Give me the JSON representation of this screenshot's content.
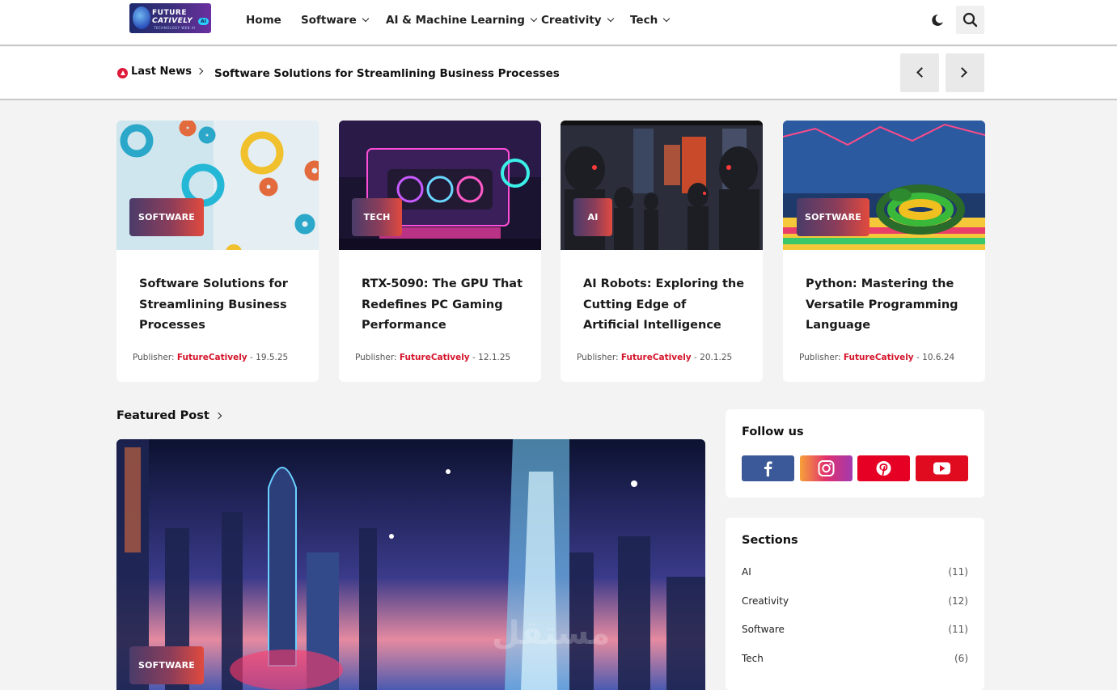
{
  "header": {
    "logo": {
      "line1": "FUTURE",
      "line2": "CATIVELY",
      "line3": "TECHNOLOGY WEB AI",
      "badge": "AI"
    },
    "nav": [
      {
        "label": "Home",
        "dropdown": false
      },
      {
        "label": "Software",
        "dropdown": true
      },
      {
        "label": "AI & Machine Learning",
        "dropdown": true
      },
      {
        "label": "Creativity",
        "dropdown": true
      },
      {
        "label": "Tech",
        "dropdown": true
      }
    ],
    "icons": {
      "theme": "moon-icon",
      "search": "search-icon"
    }
  },
  "newsbar": {
    "label": "Last News",
    "headline": "Software Solutions for Streamlining Business Processes"
  },
  "cards": [
    {
      "badge": "SOFTWARE",
      "title": "Software Solutions for Streamlining Business Processes",
      "publisher_label": "Publisher:",
      "publisher": "FutureCatively",
      "date": "19.5.25"
    },
    {
      "badge": "TECH",
      "title": "RTX-5090: The GPU That Redefines PC Gaming Performance",
      "publisher_label": "Publisher:",
      "publisher": "FutureCatively",
      "date": "12.1.25"
    },
    {
      "badge": "AI",
      "title": "AI Robots: Exploring the Cutting Edge of Artificial Intelligence",
      "publisher_label": "Publisher:",
      "publisher": "FutureCatively",
      "date": "20.1.25"
    },
    {
      "badge": "SOFTWARE",
      "title": "Python: Mastering the Versatile Programming Language",
      "publisher_label": "Publisher:",
      "publisher": "FutureCatively",
      "date": "10.6.24"
    }
  ],
  "featured": {
    "heading": "Featured Post",
    "badge": "SOFTWARE"
  },
  "follow": {
    "title": "Follow us",
    "networks": [
      {
        "name": "facebook-icon",
        "color": "#3b5998"
      },
      {
        "name": "instagram-icon",
        "color": "#e1306c"
      },
      {
        "name": "pinterest-icon",
        "color": "#e60023"
      },
      {
        "name": "youtube-icon",
        "color": "#e00b1f"
      }
    ]
  },
  "sections": {
    "title": "Sections",
    "items": [
      {
        "label": "AI",
        "count": "(11)"
      },
      {
        "label": "Creativity",
        "count": "(12)"
      },
      {
        "label": "Software",
        "count": "(11)"
      },
      {
        "label": "Tech",
        "count": "(6)"
      }
    ]
  },
  "watermark": "مستقل"
}
